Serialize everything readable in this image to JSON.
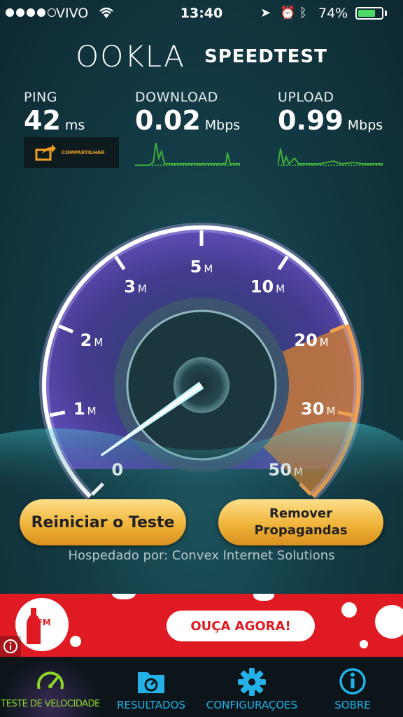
{
  "status_bar": {
    "carrier": "VIVO",
    "time": "13:40",
    "battery": "74%",
    "battery_level": 0.74
  },
  "header": {
    "logo_brand": "OOKLA",
    "logo_product": "SPEEDTEST"
  },
  "metrics": {
    "ping": {
      "label": "PING",
      "value": "42",
      "unit": "ms"
    },
    "download": {
      "label": "DOWNLOAD",
      "value": "0.02",
      "unit": "Mbps"
    },
    "upload": {
      "label": "UPLOAD",
      "value": "0.99",
      "unit": "Mbps"
    },
    "share_label": "COMPARTILHAR"
  },
  "gauge": {
    "ticks": [
      {
        "num": "0",
        "unit": ""
      },
      {
        "num": "1",
        "unit": "M"
      },
      {
        "num": "2",
        "unit": "M"
      },
      {
        "num": "3",
        "unit": "M"
      },
      {
        "num": "5",
        "unit": "M"
      },
      {
        "num": "10",
        "unit": "M"
      },
      {
        "num": "20",
        "unit": "M"
      },
      {
        "num": "30",
        "unit": "M"
      },
      {
        "num": "50",
        "unit": "M"
      }
    ],
    "needle_fraction": 0.0,
    "colors": {
      "ring": "#ffffff",
      "low": "#6a4fc8",
      "high": "#e2892e"
    }
  },
  "actions": {
    "restart_label": "Reiniciar o Teste",
    "remove_ads_line1": "Remover",
    "remove_ads_line2": "Propagandas",
    "hosted_by": "Hospedado por: Convex Internet Solutions"
  },
  "ad": {
    "brand": "FM",
    "cta": "OUÇA AGORA!",
    "bg_color": "#e01a22"
  },
  "tabs": [
    {
      "label": "TESTE DE VELOCIDADE",
      "icon": "speedometer-icon",
      "active": true,
      "color": "#8cd62a"
    },
    {
      "label": "RESULTADOS",
      "icon": "folder-icon",
      "active": false,
      "color": "#22b2e8"
    },
    {
      "label": "CONFIGURAÇOES",
      "icon": "gear-icon",
      "active": false,
      "color": "#22b2e8"
    },
    {
      "label": "SOBRE",
      "icon": "info-icon",
      "active": false,
      "color": "#22b2e8"
    }
  ]
}
